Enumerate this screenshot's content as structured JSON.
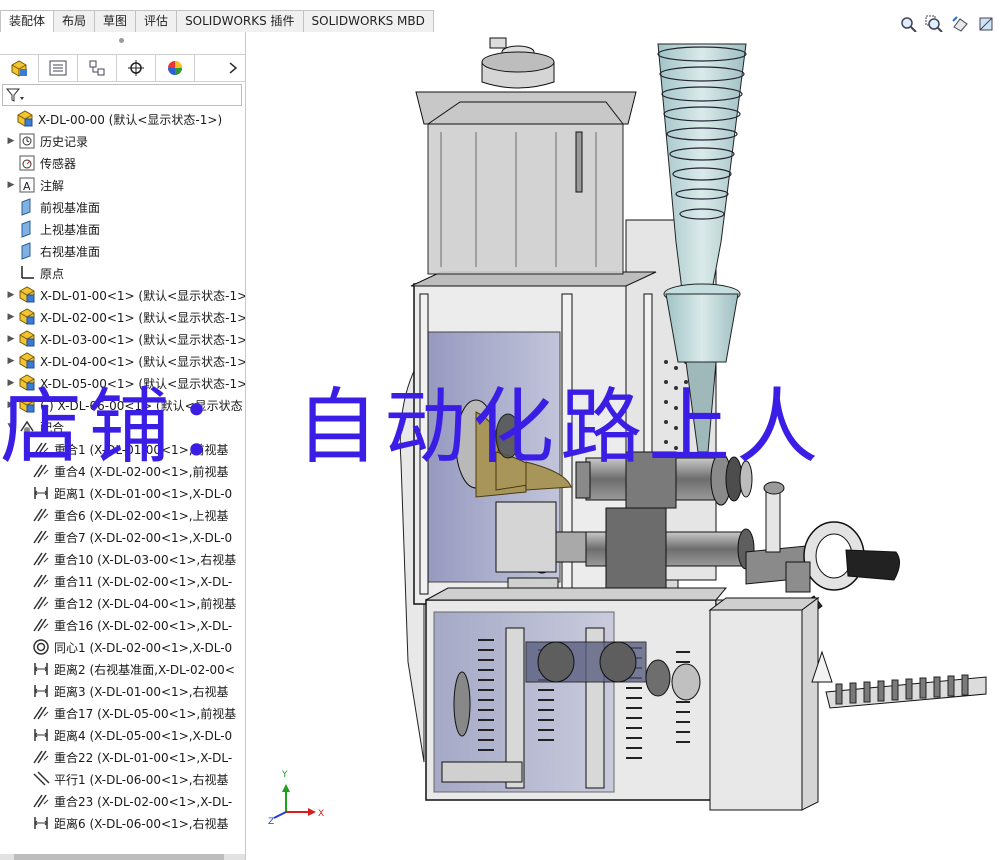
{
  "tabs": [
    {
      "label": "装配体",
      "active": true
    },
    {
      "label": "布局"
    },
    {
      "label": "草图"
    },
    {
      "label": "评估"
    },
    {
      "label": "SOLIDWORKS 插件"
    },
    {
      "label": "SOLIDWORKS MBD"
    }
  ],
  "view_tools": [
    "zoom-to-fit-icon",
    "zoom-to-area-icon",
    "previous-view-icon",
    "section-view-icon"
  ],
  "manager_tabs": [
    "feature-manager-icon",
    "property-manager-icon",
    "configuration-manager-icon",
    "dim-xpert-icon",
    "display-manager-icon"
  ],
  "tree": [
    {
      "label": "X-DL-00-00  (默认<显示状态-1>)",
      "icon": "assembly-icon",
      "expander": "",
      "indent": 0
    },
    {
      "label": "历史记录",
      "icon": "history-icon",
      "expander": "▶",
      "indent": 1
    },
    {
      "label": "传感器",
      "icon": "sensor-icon",
      "expander": "",
      "indent": 1
    },
    {
      "label": "注解",
      "icon": "annotation-icon",
      "expander": "▶",
      "indent": 1
    },
    {
      "label": "前视基准面",
      "icon": "plane-icon",
      "expander": "",
      "indent": 1
    },
    {
      "label": "上视基准面",
      "icon": "plane-icon",
      "expander": "",
      "indent": 1
    },
    {
      "label": "右视基准面",
      "icon": "plane-icon",
      "expander": "",
      "indent": 1
    },
    {
      "label": "原点",
      "icon": "origin-icon",
      "expander": "",
      "indent": 1
    },
    {
      "label": "X-DL-01-00<1> (默认<显示状态-1>",
      "icon": "assembly-icon",
      "expander": "▶",
      "indent": 1
    },
    {
      "label": "X-DL-02-00<1> (默认<显示状态-1>",
      "icon": "assembly-icon",
      "expander": "▶",
      "indent": 1
    },
    {
      "label": "X-DL-03-00<1> (默认<显示状态-1>",
      "icon": "assembly-icon",
      "expander": "▶",
      "indent": 1
    },
    {
      "label": "X-DL-04-00<1> (默认<显示状态-1>",
      "icon": "assembly-icon",
      "expander": "▶",
      "indent": 1
    },
    {
      "label": "X-DL-05-00<1> (默认<显示状态-1>",
      "icon": "assembly-icon",
      "expander": "▶",
      "indent": 1
    },
    {
      "label": "(-) X-DL-06-00<1> (默认<显示状态",
      "icon": "assembly-icon",
      "expander": "▶",
      "indent": 1
    },
    {
      "label": "配合",
      "icon": "mates-icon",
      "expander": "▼",
      "indent": 1
    },
    {
      "label": "重合1 (X-DL-01-00<1>,前视基",
      "icon": "coincident-icon",
      "expander": "",
      "indent": 2
    },
    {
      "label": "重合4 (X-DL-02-00<1>,前视基",
      "icon": "coincident-icon",
      "expander": "",
      "indent": 2
    },
    {
      "label": "距离1 (X-DL-01-00<1>,X-DL-0",
      "icon": "distance-icon",
      "expander": "",
      "indent": 2
    },
    {
      "label": "重合6 (X-DL-02-00<1>,上视基",
      "icon": "coincident-icon",
      "expander": "",
      "indent": 2
    },
    {
      "label": "重合7 (X-DL-02-00<1>,X-DL-0",
      "icon": "coincident-icon",
      "expander": "",
      "indent": 2
    },
    {
      "label": "重合10 (X-DL-03-00<1>,右视基",
      "icon": "coincident-icon",
      "expander": "",
      "indent": 2
    },
    {
      "label": "重合11 (X-DL-02-00<1>,X-DL-",
      "icon": "coincident-icon",
      "expander": "",
      "indent": 2
    },
    {
      "label": "重合12 (X-DL-04-00<1>,前视基",
      "icon": "coincident-icon",
      "expander": "",
      "indent": 2
    },
    {
      "label": "重合16 (X-DL-02-00<1>,X-DL-",
      "icon": "coincident-icon",
      "expander": "",
      "indent": 2
    },
    {
      "label": "同心1 (X-DL-02-00<1>,X-DL-0",
      "icon": "concentric-icon",
      "expander": "",
      "indent": 2
    },
    {
      "label": "距离2 (右视基准面,X-DL-02-00<",
      "icon": "distance-icon",
      "expander": "",
      "indent": 2
    },
    {
      "label": "距离3 (X-DL-01-00<1>,右视基",
      "icon": "distance-icon",
      "expander": "",
      "indent": 2
    },
    {
      "label": "重合17 (X-DL-05-00<1>,前视基",
      "icon": "coincident-icon",
      "expander": "",
      "indent": 2
    },
    {
      "label": "距离4 (X-DL-05-00<1>,X-DL-0",
      "icon": "distance-icon",
      "expander": "",
      "indent": 2
    },
    {
      "label": "重合22 (X-DL-01-00<1>,X-DL-",
      "icon": "coincident-icon",
      "expander": "",
      "indent": 2
    },
    {
      "label": "平行1 (X-DL-06-00<1>,右视基",
      "icon": "parallel-icon",
      "expander": "",
      "indent": 2
    },
    {
      "label": "重合23 (X-DL-02-00<1>,X-DL-",
      "icon": "coincident-icon",
      "expander": "",
      "indent": 2
    },
    {
      "label": "距离6 (X-DL-06-00<1>,右视基",
      "icon": "distance-icon",
      "expander": "",
      "indent": 2
    }
  ],
  "triad": {
    "x": "X",
    "y": "Y",
    "z": "Z"
  },
  "watermark": "店铺：  自动化路上人"
}
